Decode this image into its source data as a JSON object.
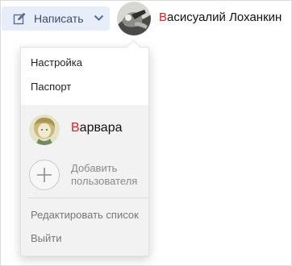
{
  "header": {
    "compose_label": "Написать",
    "compose_icon": "pencil-square-icon",
    "dropdown_icon": "chevron-down-icon",
    "user": {
      "first_letter": "В",
      "rest": "асисуалий Лоханкин"
    }
  },
  "menu": {
    "settings_label": "Настройка",
    "passport_label": "Паспорт",
    "account": {
      "first_letter": "В",
      "rest": "арвара"
    },
    "add_user_label": "Добавить пользователя",
    "edit_list_label": "Редактировать список",
    "logout_label": "Выйти"
  },
  "colors": {
    "accent_letter": "#e02020",
    "compose_bg": "#e8eef9",
    "compose_text": "#3a4d6f"
  }
}
